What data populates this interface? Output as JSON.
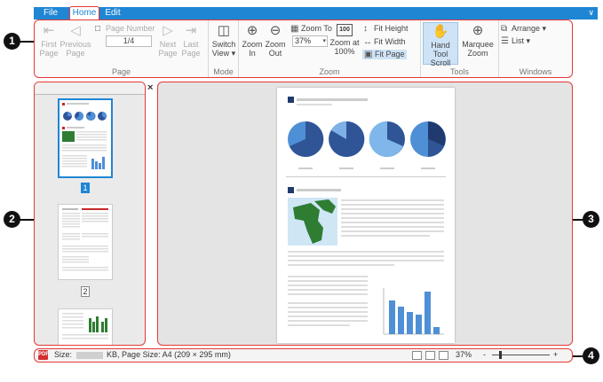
{
  "tabs": [
    {
      "label": "File"
    },
    {
      "label": "Home"
    },
    {
      "label": "Edit"
    }
  ],
  "ribbon": {
    "page": {
      "group_label": "Page",
      "first": "First\nPage",
      "first_l1": "First",
      "first_l2": "Page",
      "prev_l1": "Previous",
      "prev_l2": "Page",
      "page_number_label": "Page Number",
      "page_number_value": "1/4",
      "next_l1": "Next",
      "next_l2": "Page",
      "last_l1": "Last",
      "last_l2": "Page"
    },
    "mode": {
      "group_label": "Mode",
      "switch_l1": "Switch",
      "switch_l2": "View"
    },
    "zoom": {
      "group_label": "Zoom",
      "zoom_in_l1": "Zoom",
      "zoom_in_l2": "In",
      "zoom_out_l1": "Zoom",
      "zoom_out_l2": "Out",
      "zoom_to_label": "Zoom To",
      "zoom_to_value": "37%",
      "zoom_100_icon": "100",
      "zoom_100_l1": "Zoom at",
      "zoom_100_l2": "100%",
      "fit_height": "Fit Height",
      "fit_width": "Fit Width",
      "fit_page": "Fit Page"
    },
    "tools": {
      "group_label": "Tools",
      "hand_l1": "Hand Tool",
      "hand_l2": "Scroll",
      "marquee_l1": "Marquee",
      "marquee_l2": "Zoom"
    },
    "windows": {
      "group_label": "Windows",
      "arrange": "Arrange",
      "list": "List"
    }
  },
  "callouts": [
    "1",
    "2",
    "3",
    "4"
  ],
  "thumbnails": {
    "close": "×",
    "pages": [
      {
        "number": "1",
        "selected": true
      },
      {
        "number": "2",
        "selected": false
      }
    ]
  },
  "status": {
    "pdf_icon": "PDF",
    "size_prefix": "Size:",
    "size_suffix": "KB, Page Size: A4 (209 × 295 mm)",
    "zoom": "37%",
    "zoom_minus": "-",
    "zoom_plus": "+"
  },
  "colors": {
    "accent": "#1f86d4",
    "highlight": "#e53935",
    "pie_dark": "#2f5597",
    "pie_light": "#4f8fd6",
    "map_green": "#2e7d32"
  }
}
